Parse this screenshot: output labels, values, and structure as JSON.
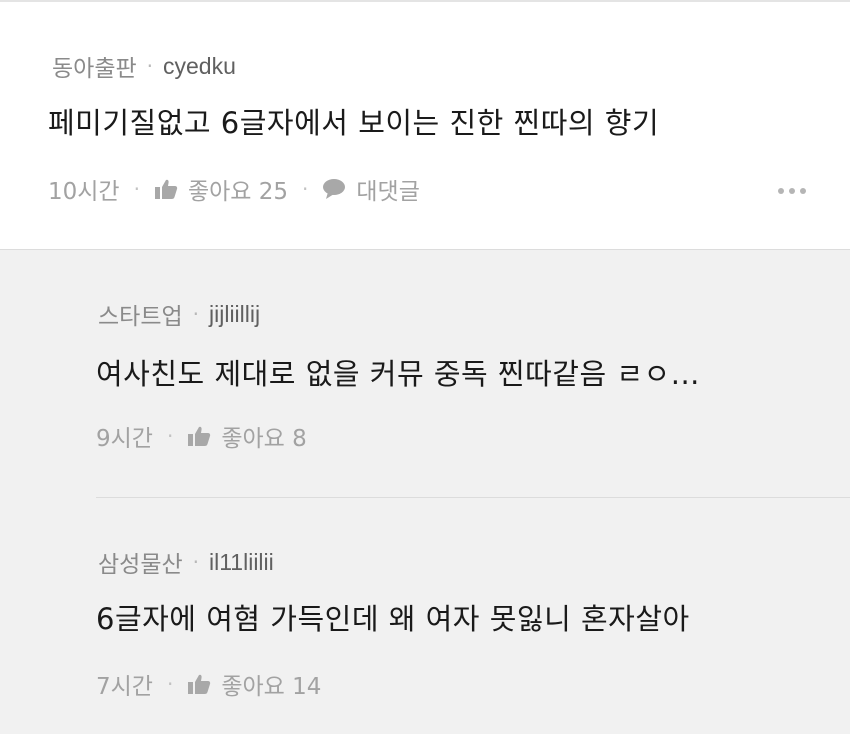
{
  "comments": [
    {
      "source": "동아출판",
      "user": "cyedku",
      "text": "페미기질없고 6글자에서 보이는 진한 찐따의 향기",
      "time": "10시간",
      "likes": "좋아요 25",
      "reply": "대댓글"
    }
  ],
  "replies": [
    {
      "source": "스타트업",
      "user": "jijliillij",
      "text": "여사친도 제대로 없을 커뮤 중독 찐따같음 ㄹㅇ...",
      "time": "9시간",
      "likes": "좋아요 8"
    },
    {
      "source": "삼성물산",
      "user": "il11liilii",
      "text": "6글자에 여혐 가득인데 왜 여자 못잃니 혼자살아",
      "time": "7시간",
      "likes": "좋아요 14"
    }
  ],
  "separator": "·",
  "icons": {
    "like": "thumbs-up-icon",
    "reply": "speech-bubble-icon",
    "more": "more-options-icon"
  },
  "colors": {
    "main_bg": "#ffffff",
    "reply_bg": "#f1f1f1",
    "text": "#1a1a1a",
    "meta": "#8a8a8a"
  }
}
